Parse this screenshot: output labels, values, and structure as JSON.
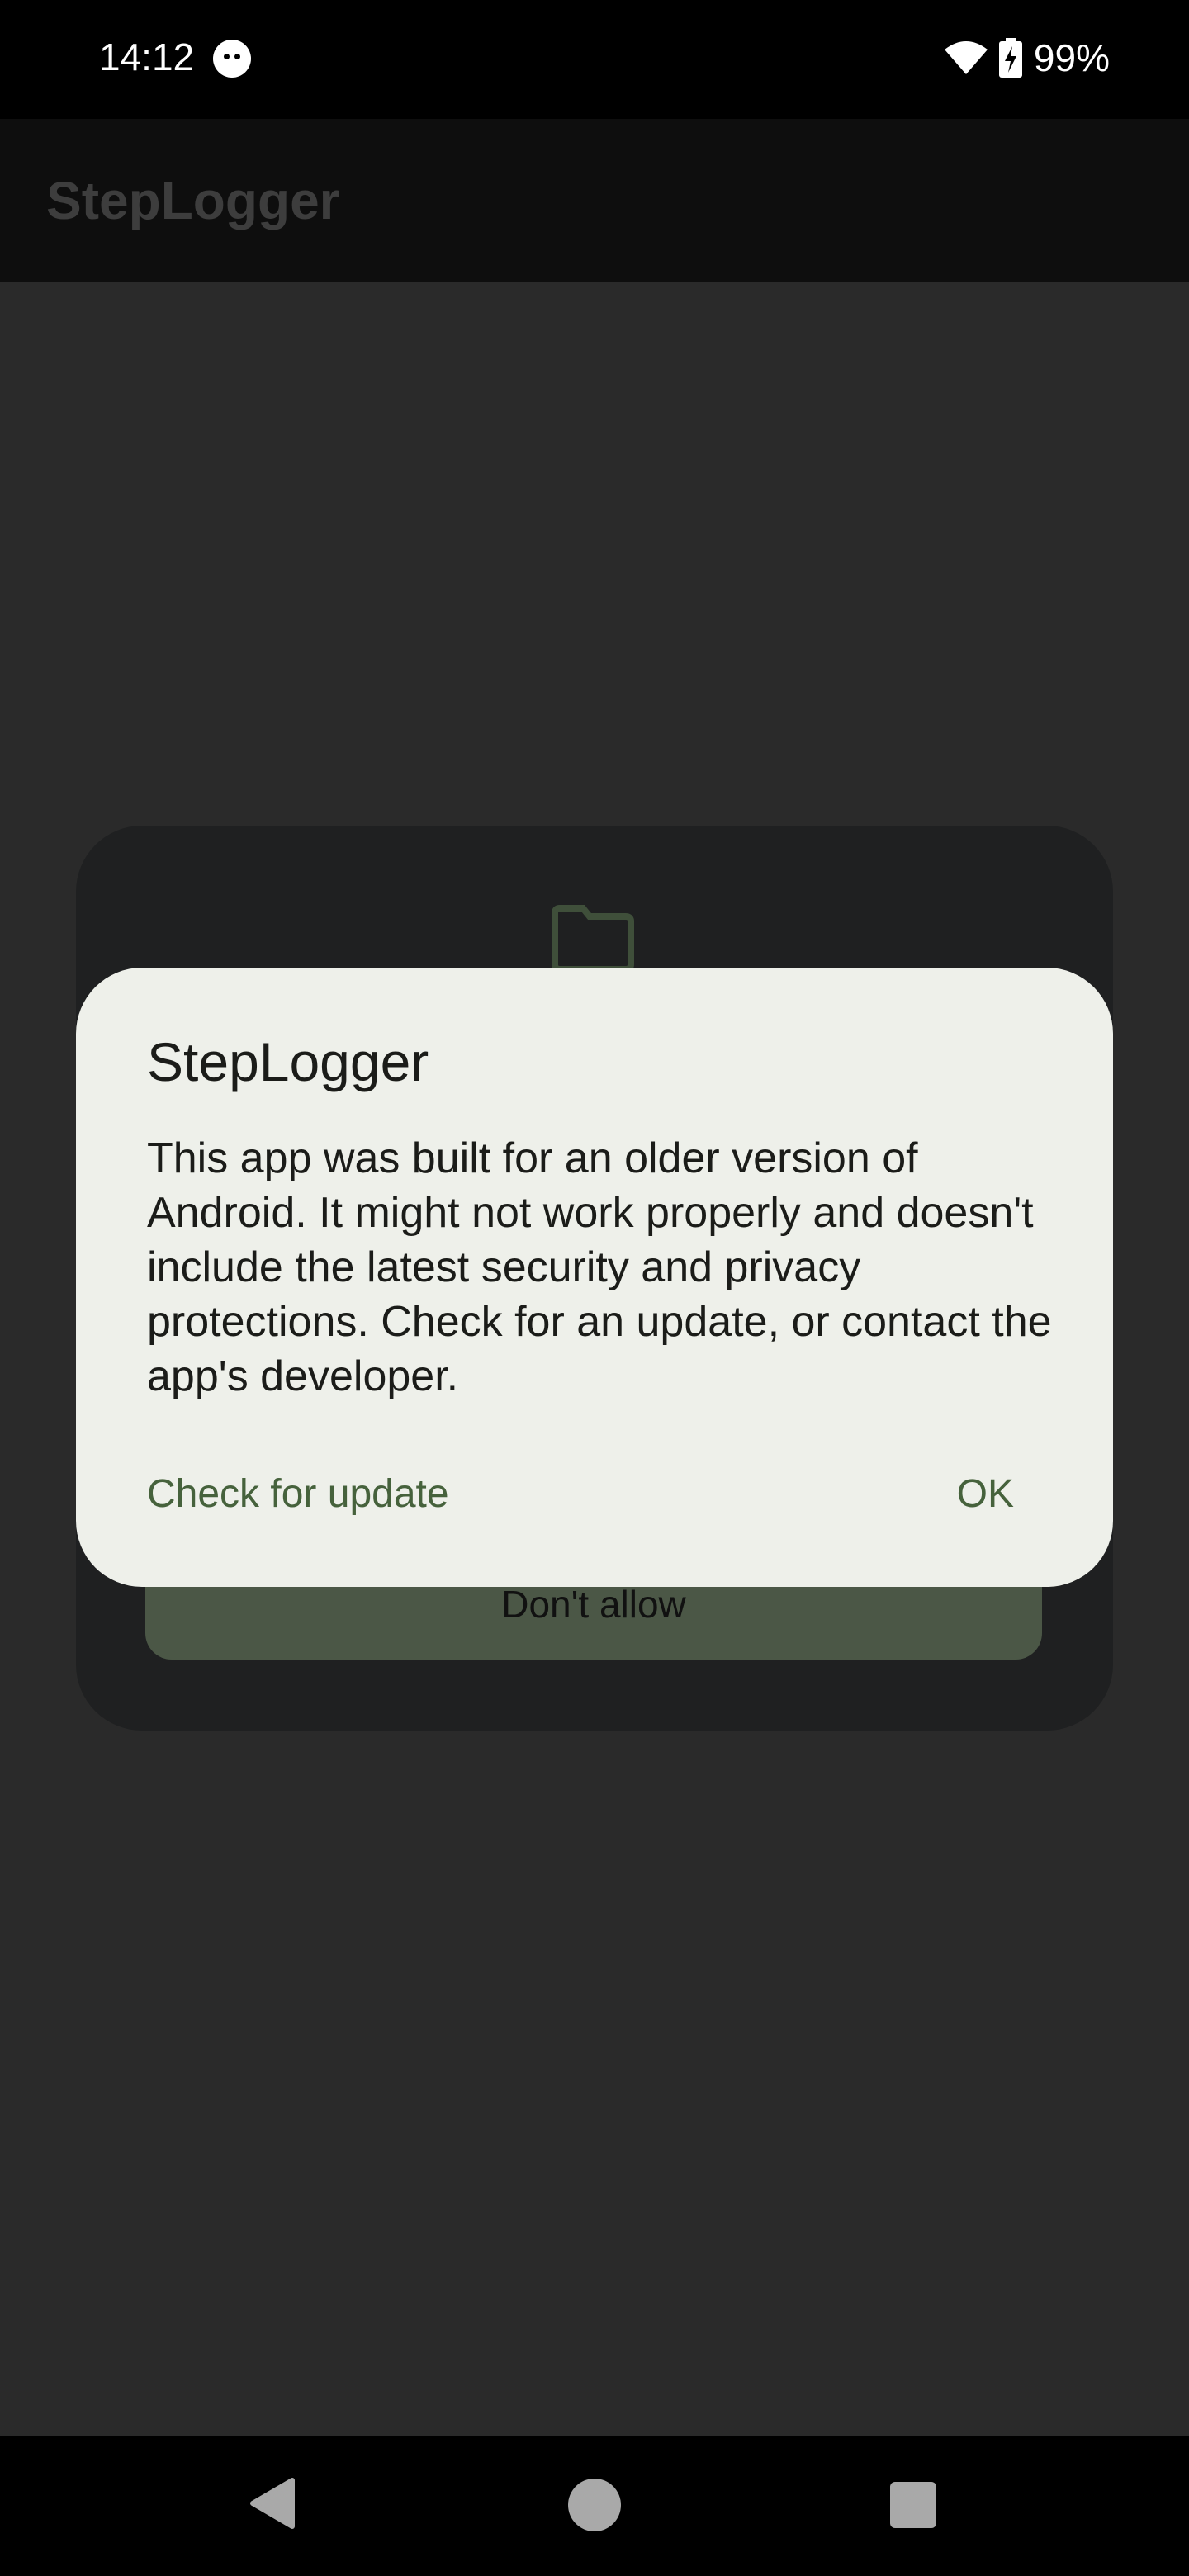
{
  "status_bar": {
    "time": "14:12",
    "app_icon": "cat-face-icon",
    "wifi_icon": "wifi-icon",
    "battery_icon": "battery-charging-icon",
    "battery": "99%"
  },
  "app_bar": {
    "title": "StepLogger"
  },
  "permission_dialog": {
    "icon": "folder-icon",
    "deny_label": "Don't allow"
  },
  "alert": {
    "title": "StepLogger",
    "message": "This app was built for an older version of Android. It might not work properly and doesn't include the latest security and privacy protections. Check for an update, or contact the app's developer.",
    "check_update_label": "Check for update",
    "ok_label": "OK"
  },
  "nav_bar": {
    "back_icon": "back-triangle-icon",
    "home_icon": "home-circle-icon",
    "recents_icon": "recents-square-icon"
  },
  "colors": {
    "accent": "#46623c",
    "dialog_surface": "#eef0ea",
    "scrim": "#2a2a2a"
  }
}
